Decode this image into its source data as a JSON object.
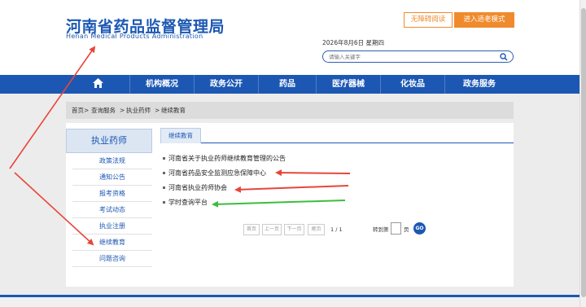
{
  "header": {
    "logo_cn": "河南省药品监督管理局",
    "logo_en": "Henan Medical Products Administration",
    "accessibility_btn": "无障碍阅读",
    "elder_mode_btn": "进入适老模式",
    "date": "2026年8月6日   星期四",
    "search_placeholder": "请输入关键字"
  },
  "nav": {
    "home_icon": "home-icon",
    "items": [
      "机构概况",
      "政务公开",
      "药品",
      "医疗器械",
      "化妆品",
      "政务服务"
    ]
  },
  "breadcrumb": [
    "首页>",
    "查询服务",
    ">",
    "执业药师",
    ">",
    "继续教育"
  ],
  "sidebar": {
    "title": "执业药师",
    "items": [
      "政策法规",
      "通知公告",
      "报考资格",
      "考试动态",
      "执业注册",
      "继续教育",
      "问题咨询"
    ]
  },
  "main": {
    "tab": "继续教育",
    "articles": [
      "河南省关于执业药师继续教育管理的公告",
      "河南省药品安全监测应急保障中心",
      "河南省执业药师协会",
      "学时查询平台"
    ]
  },
  "pagination": {
    "first": "首页",
    "prev": "上一页",
    "next": "下一页",
    "last": "尾页",
    "info": "1 / 1",
    "goto_label": "转到第",
    "page_unit": "页",
    "go": "GO"
  },
  "colors": {
    "brand_blue": "#1c58b3",
    "accent_orange": "#f08b2d",
    "arrow_red": "#e8463a",
    "arrow_green": "#3dbd3d"
  }
}
